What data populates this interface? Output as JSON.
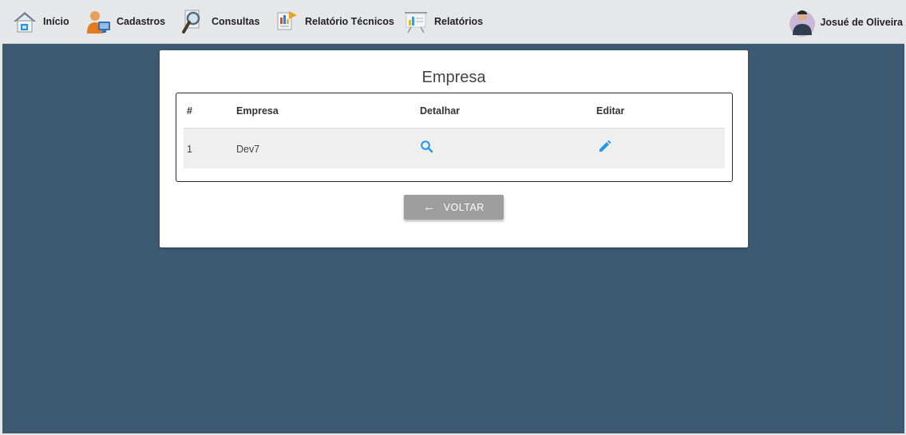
{
  "nav": {
    "items": [
      {
        "label": "Início",
        "icon": "home-icon"
      },
      {
        "label": "Cadastros",
        "icon": "users-icon"
      },
      {
        "label": "Consultas",
        "icon": "magnifier-icon"
      },
      {
        "label": "Relatório Técnicos",
        "icon": "report-icon"
      },
      {
        "label": "Relatórios",
        "icon": "presentation-chart-icon"
      }
    ],
    "user_name": "Josué de Oliveira"
  },
  "card": {
    "title": "Empresa",
    "table": {
      "headers": [
        "#",
        "Empresa",
        "Detalhar",
        "Editar"
      ],
      "rows": [
        {
          "id": "1",
          "empresa": "Dev7",
          "detalhar_icon": "search-icon",
          "editar_icon": "pencil-icon"
        }
      ]
    },
    "back_button": {
      "arrow": "←",
      "label": "VOLTAR"
    }
  },
  "colors": {
    "background": "#3d5a72",
    "navbar": "#e6e7e8",
    "action_icon": "#2196f3",
    "button": "#9e9e9e"
  }
}
